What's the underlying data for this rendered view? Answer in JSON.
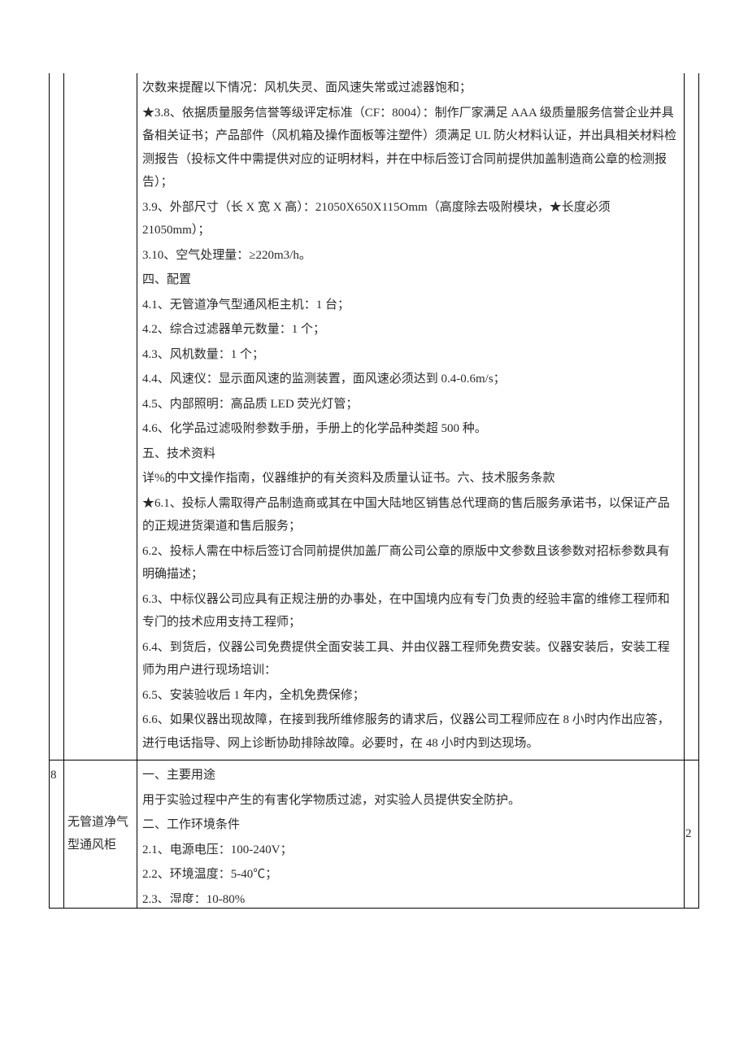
{
  "row7": {
    "spec": {
      "p3_7b": "次数来提醒以下情况：风机失灵、面风速失常或过滤器饱和；",
      "p3_8": "★3.8、依据质量服务信誉等级评定标准（CF：8004）：制作厂家满足 AAA 级质量服务信誉企业并具备相关证书；产品部件（风机箱及操作面板等注塑件）须满足 UL 防火材料认证，并出具相关材料检测报告（投标文件中需提供对应的证明材料，并在中标后签订合同前提供加盖制造商公章的检测报告）；",
      "p3_9": "3.9、外部尺寸（长 X 宽 X 高）：21050X650X115Omm（高度除去吸附模块，★长度必须 21050mm）；",
      "p3_10": "3.10、空气处理量：≥220m3/h。",
      "s4_title": "四、配置",
      "p4_1": "4.1、无管道净气型通风柜主机：1 台；",
      "p4_2": "4.2、综合过滤器单元数量：1 个；",
      "p4_3": "4.3、风机数量：1 个；",
      "p4_4": "4.4、风速仪：显示面风速的监测装置，面风速必须达到 0.4-0.6m/s；",
      "p4_5": "4.5、内部照明：高品质 LED 荧光灯管；",
      "p4_6": "4.6、化学品过滤吸附参数手册，手册上的化学品种类超 500 种。",
      "s5_title": "五、技术资料",
      "p5_1": "详%的中文操作指南，仪器维护的有关资料及质量认证书。六、技术服务条款",
      "p6_1": "★6.1、投标人需取得产品制造商或其在中国大陆地区销售总代理商的售后服务承诺书，以保证产品的正规进货渠道和售后服务；",
      "p6_2": "6.2、投标人需在中标后签订合同前提供加盖厂商公司公章的原版中文参数且该参数对招标参数具有明确描述；",
      "p6_3": "6.3、中标仪器公司应具有正规注册的办事处，在中国境内应有专门负责的经验丰富的维修工程师和专门的技术应用支持工程师；",
      "p6_4": "6.4、到货后，仪器公司免费提供全面安装工具、并由仪器工程师免费安装。仪器安装后，安装工程师为用户进行现场培训：",
      "p6_5": "6.5、安装验收后 1 年内，全机免费保修；",
      "p6_6": "6.6、如果仪器出现故障，在接到我所维修服务的请求后，仪器公司工程师应在 8 小时内作出应答，进行电话指导、网上诊断协助排除故障。必要时，在 48 小时内到达现场。"
    }
  },
  "row8": {
    "idx": "8",
    "name": "无管道净气型通风柜",
    "qty": "2",
    "spec": {
      "s1_title": "一、主要用途",
      "p1_1": "用于实验过程中产生的有害化学物质过滤，对实验人员提供安全防护。",
      "s2_title": "二、工作环境条件",
      "p2_1": "2.1、电源电压：100-240V；",
      "p2_2": "2.2、环境温度：5-40℃；",
      "p2_3": "2.3、湿度：10-80%"
    }
  }
}
